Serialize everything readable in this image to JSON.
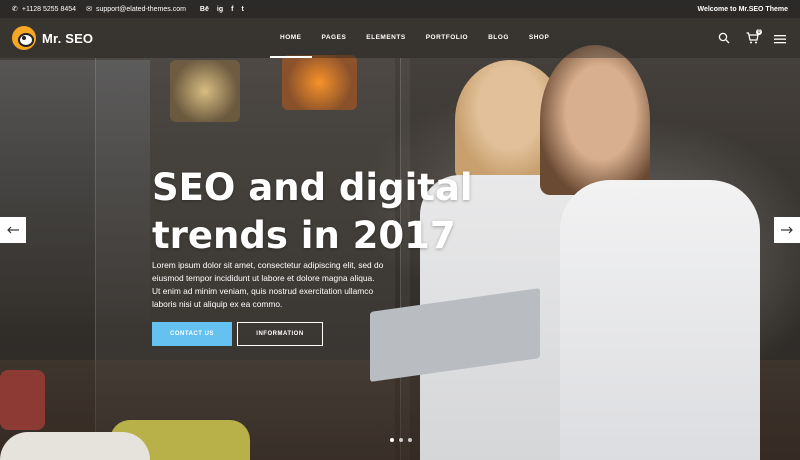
{
  "topbar": {
    "phone": "+1128 5255 8454",
    "email": "support@elated-themes.com",
    "social": [
      "Bē",
      "ig",
      "f",
      "t"
    ],
    "welcome": "Welcome to Mr.SEO Theme"
  },
  "header": {
    "logo_text": "Mr. SEO",
    "nav": [
      {
        "label": "HOME",
        "active": true
      },
      {
        "label": "PAGES",
        "active": false
      },
      {
        "label": "ELEMENTS",
        "active": false
      },
      {
        "label": "PORTFOLIO",
        "active": false
      },
      {
        "label": "BLOG",
        "active": false
      },
      {
        "label": "SHOP",
        "active": false
      }
    ],
    "cart_count": "0",
    "icons": [
      "search-icon",
      "cart-icon",
      "menu-icon"
    ]
  },
  "hero": {
    "headline_line1": "SEO and digital",
    "headline_line2": "trends in 2017",
    "lead": "Lorem ipsum dolor sit amet, consectetur adipiscing elit, sed do eiusmod tempor incididunt ut labore et dolore magna aliqua. Ut enim ad minim veniam, quis nostrud exercitation ullamco laboris nisi ut aliquip ex ea commo.",
    "primary_button": "CONTACT US",
    "secondary_button": "INFORMATION",
    "slides": 3,
    "active_slide": 1
  },
  "colors": {
    "accent": "#64c1f0",
    "logo": "#f5a623"
  }
}
